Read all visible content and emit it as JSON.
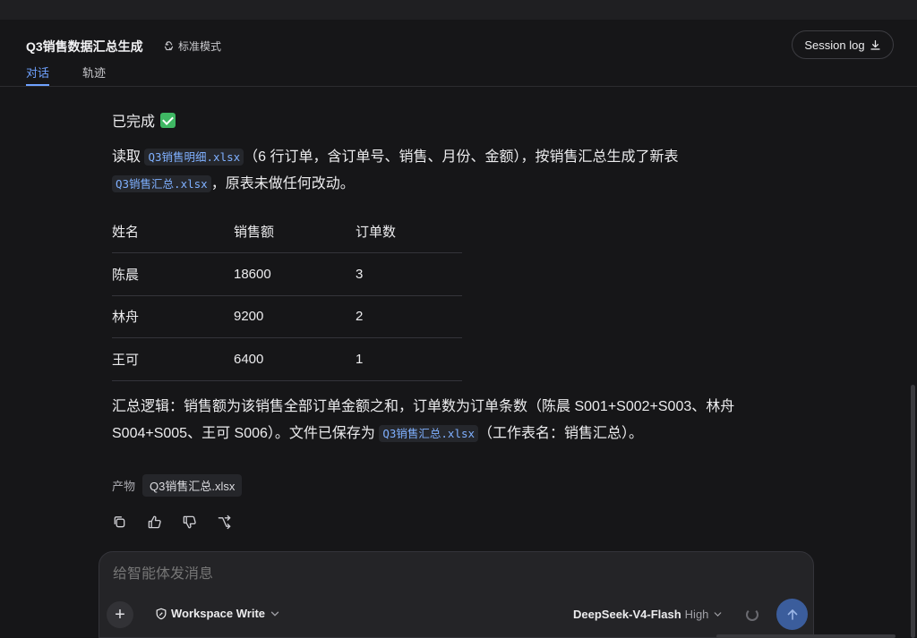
{
  "header": {
    "title": "Q3销售数据汇总生成",
    "mode_label": "标准模式",
    "session_log_label": "Session log",
    "tabs": [
      {
        "label": "对话",
        "active": true
      },
      {
        "label": "轨迹",
        "active": false
      }
    ]
  },
  "message": {
    "status": "已完成",
    "intro_prefix": "读取",
    "source_file": "Q3销售明细.xlsx",
    "intro_middle": "（6 行订单，含订单号、销售、月份、金额），按销售汇总生成了新表",
    "output_file": "Q3销售汇总.xlsx",
    "intro_suffix": "，原表未做任何改动。",
    "table": {
      "headers": [
        "姓名",
        "销售额",
        "订单数"
      ],
      "rows": [
        [
          "陈晨",
          "18600",
          "3"
        ],
        [
          "林舟",
          "9200",
          "2"
        ],
        [
          "王可",
          "6400",
          "1"
        ]
      ]
    },
    "summary_prefix": "汇总逻辑：销售额为该销售全部订单金额之和，订单数为订单条数（陈晨 S001+S002+S003、林舟",
    "summary_line2_prefix": "S004+S005、王可 S006）。文件已保存为",
    "summary_file": "Q3销售汇总.xlsx",
    "summary_suffix": "（工作表名：销售汇总）。",
    "artifact_label": "产物",
    "artifact_file": "Q3销售汇总.xlsx"
  },
  "actions": [
    "copy-icon",
    "thumbs-up-icon",
    "thumbs-down-icon",
    "branch-icon"
  ],
  "composer": {
    "placeholder": "给智能体发消息",
    "workspace_label": "Workspace Write",
    "model_name": "DeepSeek-V4-Flash",
    "model_level": "High"
  },
  "colors": {
    "accent": "#6fa2ff",
    "background": "#161618",
    "send_button": "#3b5d9c",
    "check": "#3fb763"
  }
}
